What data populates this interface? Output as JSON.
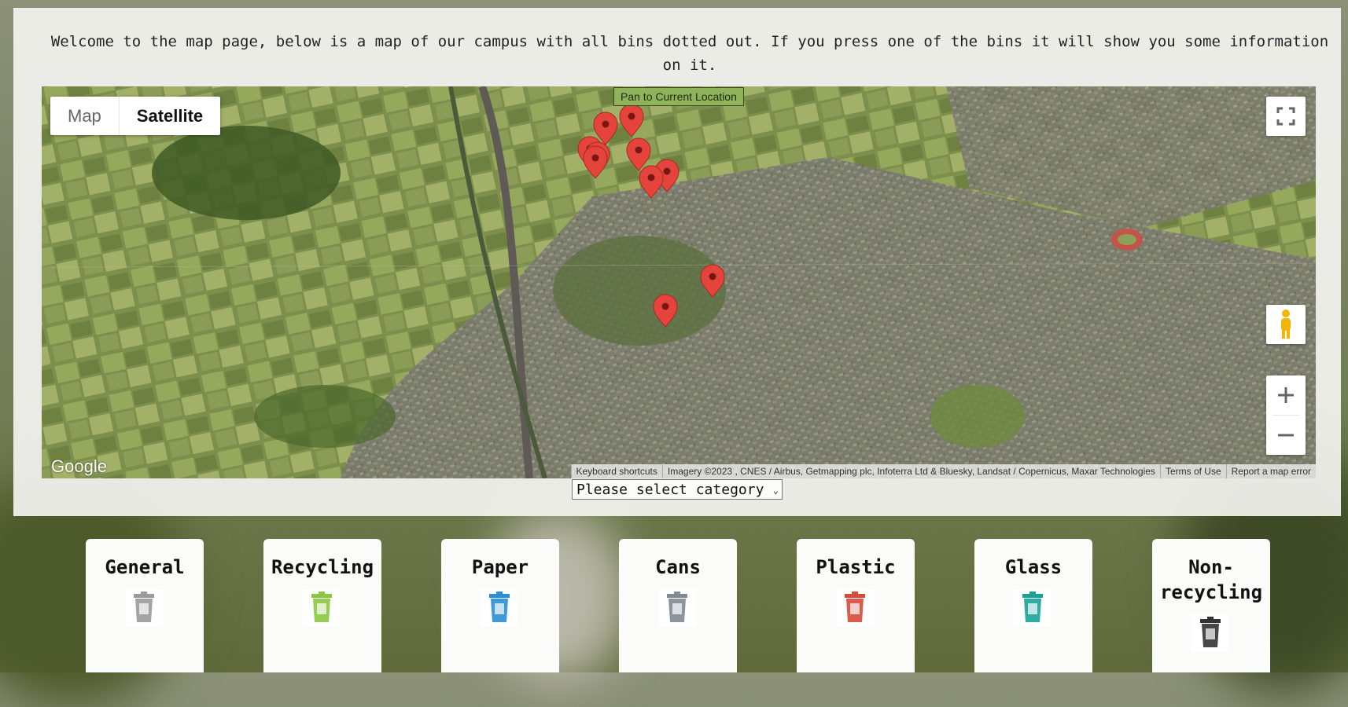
{
  "intro_text": "Welcome to the map page, below is a map of our campus with all bins dotted out. If you press one of the bins it will show you some information on it.",
  "map": {
    "type_buttons": {
      "map": "Map",
      "satellite": "Satellite"
    },
    "selected_type": "Satellite",
    "pan_button": "Pan to Current Location",
    "logo": "Google",
    "attribution": {
      "shortcuts": "Keyboard shortcuts",
      "imagery": "Imagery ©2023 , CNES / Airbus, Getmapping plc, Infoterra Ltd & Bluesky, Landsat / Copernicus, Maxar Technologies",
      "terms": "Terms of Use",
      "report": "Report a map error"
    },
    "marker_color": "#e5443d",
    "marker_count": 11
  },
  "category_select": {
    "selected": "Please select category"
  },
  "categories": [
    {
      "label": "General",
      "icon": "general-bin-icon",
      "color": "#9a9a9a"
    },
    {
      "label": "Recycling",
      "icon": "recycling-bin-icon",
      "color": "#8cc63f"
    },
    {
      "label": "Paper",
      "icon": "paper-bin-icon",
      "color": "#2a8fd6"
    },
    {
      "label": "Cans",
      "icon": "cans-bin-icon",
      "color": "#7f8a93"
    },
    {
      "label": "Plastic",
      "icon": "plastic-bin-icon",
      "color": "#d64a3a"
    },
    {
      "label": "Glass",
      "icon": "glass-bin-icon",
      "color": "#1aa19a"
    },
    {
      "label": "Non-\nrecycling",
      "icon": "non-recycling-bin-icon",
      "color": "#333333"
    }
  ]
}
